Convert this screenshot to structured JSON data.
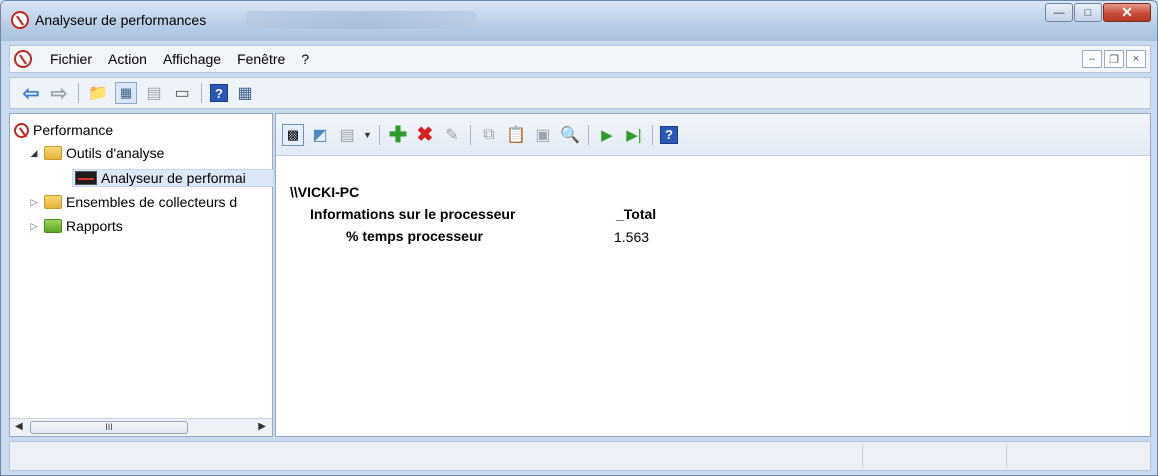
{
  "window": {
    "title": "Analyseur de performances"
  },
  "menubar": {
    "items": [
      "Fichier",
      "Action",
      "Affichage",
      "Fenêtre",
      "?"
    ]
  },
  "tree": {
    "root": "Performance",
    "tools": "Outils d'analyse",
    "monitor": "Analyseur de performai",
    "collectors": "Ensembles de collecteurs d",
    "reports": "Rapports",
    "scroll_grip": "III"
  },
  "report": {
    "computer": "\\\\VICKI-PC",
    "object": "Informations sur le processeur",
    "instance": "_Total",
    "counter": "% temps processeur",
    "value": "1.563"
  },
  "colors": {
    "title_gradient_top": "#d9e6f6",
    "close_button": "#c74a36",
    "selection": "#dce8f7"
  }
}
